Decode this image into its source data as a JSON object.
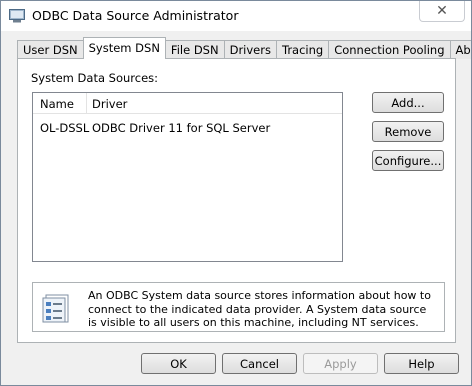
{
  "window": {
    "title": "ODBC Data Source Administrator",
    "close_glyph": "✕"
  },
  "tabs": [
    {
      "label": "User DSN",
      "active": false
    },
    {
      "label": "System DSN",
      "active": true
    },
    {
      "label": "File DSN",
      "active": false
    },
    {
      "label": "Drivers",
      "active": false
    },
    {
      "label": "Tracing",
      "active": false
    },
    {
      "label": "Connection Pooling",
      "active": false
    },
    {
      "label": "About",
      "active": false
    }
  ],
  "panel": {
    "section_label": "System Data Sources:",
    "list": {
      "columns": [
        "Name",
        "Driver"
      ],
      "rows": [
        {
          "name": "OL-DSSL",
          "driver": "ODBC Driver 11 for SQL Server"
        }
      ]
    },
    "buttons": {
      "add": "Add...",
      "remove": "Remove",
      "configure": "Configure..."
    },
    "info_text": "An ODBC System data source stores information about how to connect to the indicated data provider.   A System data source is visible to all users on this machine, including NT services."
  },
  "footer": {
    "ok": "OK",
    "cancel": "Cancel",
    "apply": "Apply",
    "help": "Help"
  }
}
